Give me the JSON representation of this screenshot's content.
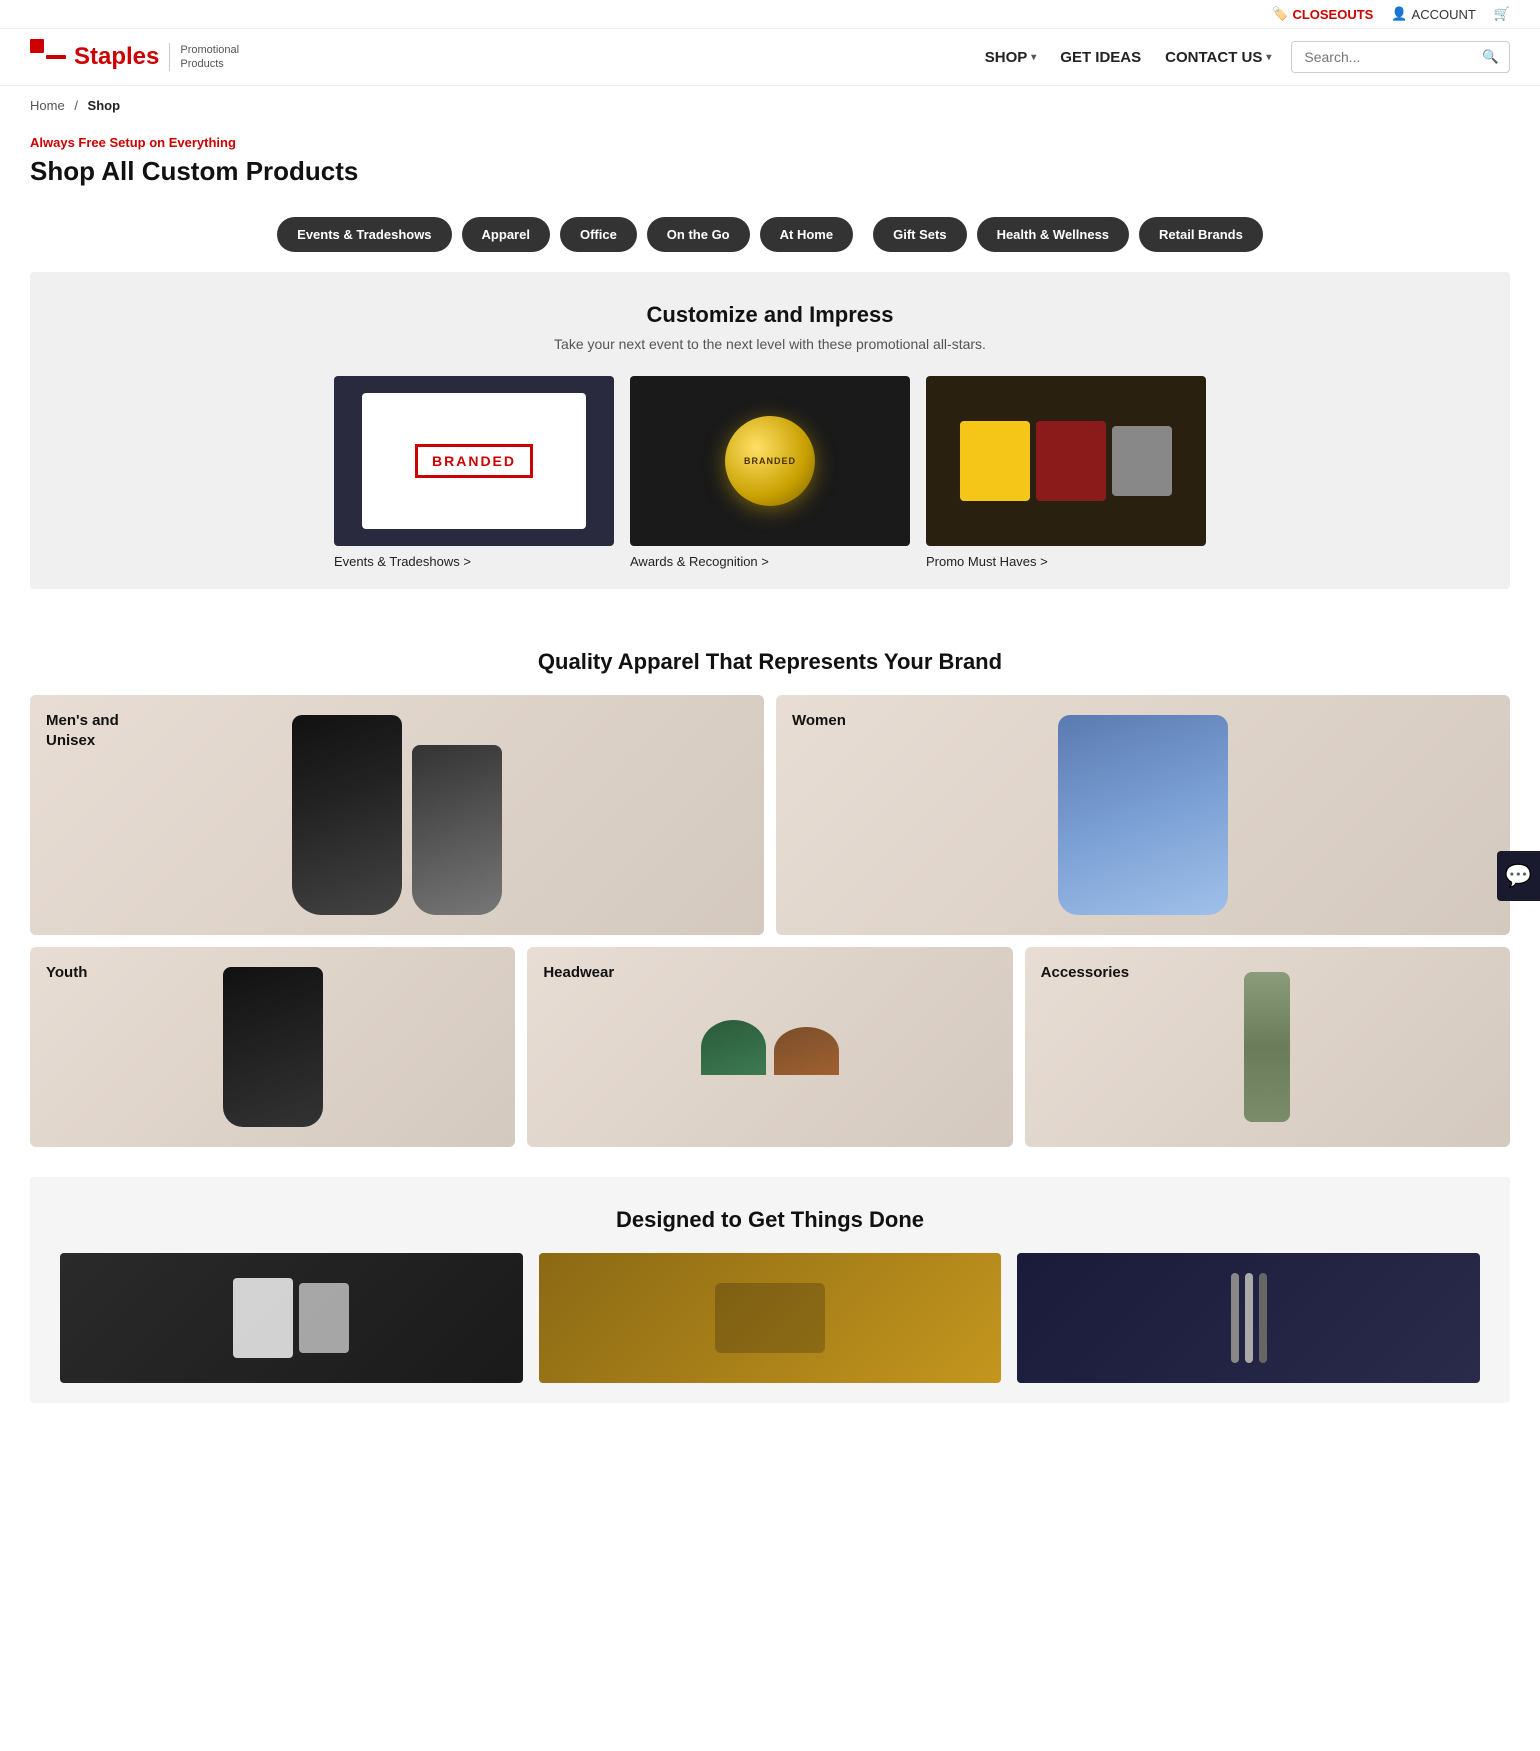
{
  "topbar": {
    "closeouts_label": "CLOSEOUTS",
    "account_label": "ACCOUNT",
    "cart_icon_label": "🛒"
  },
  "nav": {
    "logo_text": "Staples",
    "logo_promo_line1": "Promotional",
    "logo_promo_line2": "Products",
    "shop_label": "SHOP",
    "get_ideas_label": "GET IDEAS",
    "contact_us_label": "CONTACT US",
    "search_placeholder": "Search..."
  },
  "breadcrumb": {
    "home": "Home",
    "current": "Shop"
  },
  "page_header": {
    "always_free": "Always Free Setup on Everything",
    "title": "Shop All Custom Products"
  },
  "category_buttons": [
    "Events & Tradeshows",
    "Apparel",
    "Office",
    "On the Go",
    "At Home",
    "Gift Sets",
    "Health & Wellness",
    "Retail Brands"
  ],
  "customize": {
    "title": "Customize and Impress",
    "subtitle": "Take your next event to the next level with these promotional all-stars.",
    "cards": [
      {
        "label": "Events & Tradeshows >"
      },
      {
        "label": "Awards & Recognition >"
      },
      {
        "label": "Promo Must Haves >"
      }
    ]
  },
  "apparel": {
    "title": "Quality Apparel That Represents Your Brand",
    "cards": [
      {
        "label": "Men's and Unisex"
      },
      {
        "label": "Women"
      },
      {
        "label": "Youth"
      },
      {
        "label": "Headwear"
      },
      {
        "label": "Accessories"
      }
    ]
  },
  "designed": {
    "title": "Designed to Get Things Done"
  }
}
